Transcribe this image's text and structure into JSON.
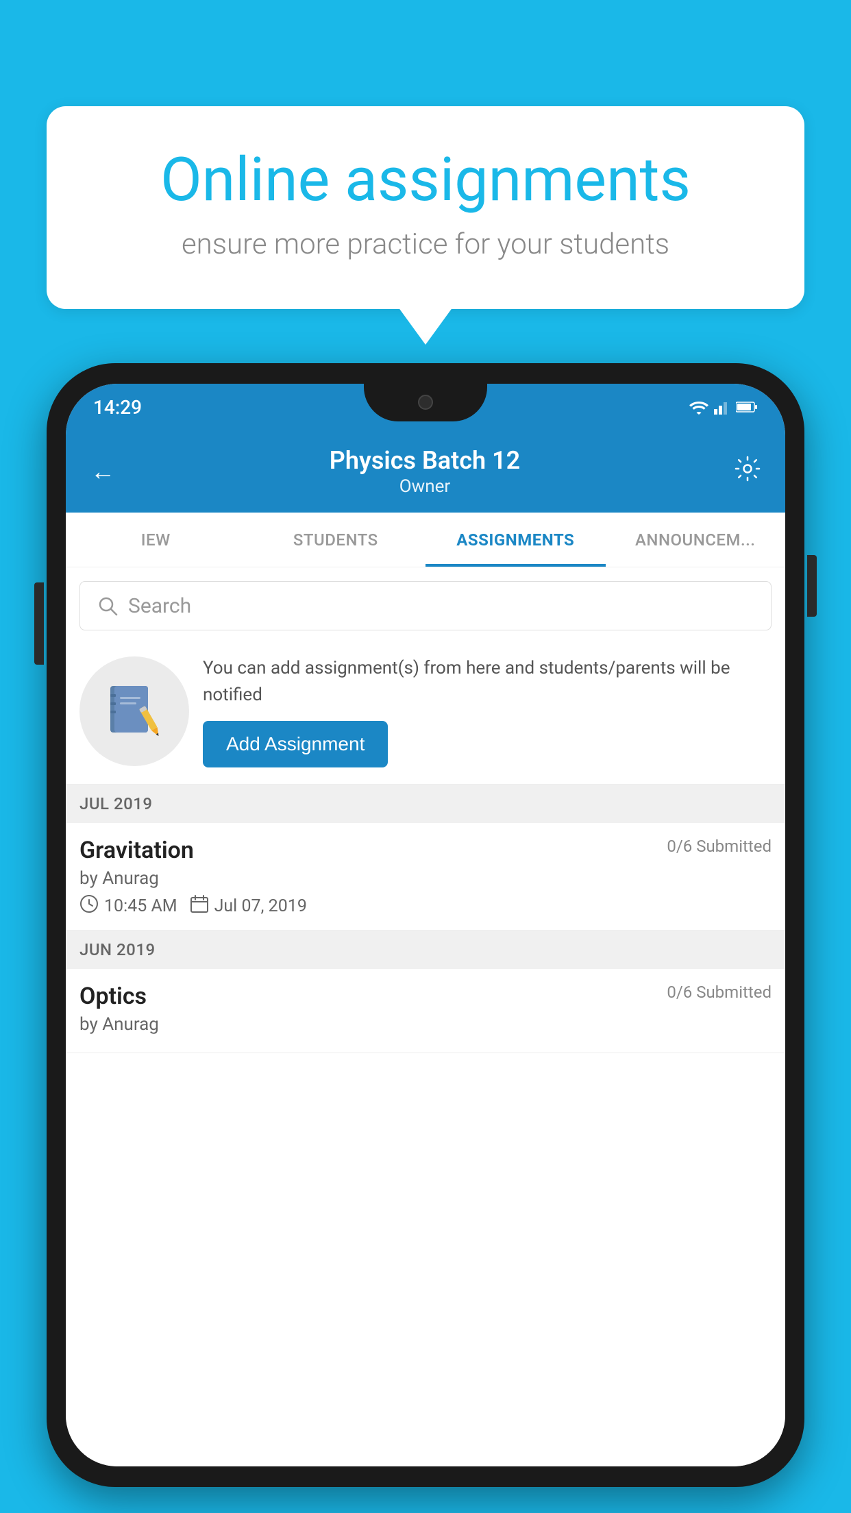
{
  "background_color": "#1ab8e8",
  "speech_bubble": {
    "title": "Online assignments",
    "subtitle": "ensure more practice for your students"
  },
  "status_bar": {
    "time": "14:29"
  },
  "header": {
    "title": "Physics Batch 12",
    "subtitle": "Owner",
    "back_label": "←",
    "settings_label": "⚙"
  },
  "tabs": [
    {
      "label": "IEW",
      "active": false
    },
    {
      "label": "STUDENTS",
      "active": false
    },
    {
      "label": "ASSIGNMENTS",
      "active": true
    },
    {
      "label": "ANNOUNCEM...",
      "active": false
    }
  ],
  "search": {
    "placeholder": "Search"
  },
  "add_assignment": {
    "description": "You can add assignment(s) from here and students/parents will be notified",
    "button_label": "Add Assignment"
  },
  "sections": [
    {
      "month": "JUL 2019",
      "assignments": [
        {
          "name": "Gravitation",
          "submitted": "0/6 Submitted",
          "author": "by Anurag",
          "time": "10:45 AM",
          "date": "Jul 07, 2019"
        }
      ]
    },
    {
      "month": "JUN 2019",
      "assignments": [
        {
          "name": "Optics",
          "submitted": "0/6 Submitted",
          "author": "by Anurag",
          "time": "",
          "date": ""
        }
      ]
    }
  ]
}
